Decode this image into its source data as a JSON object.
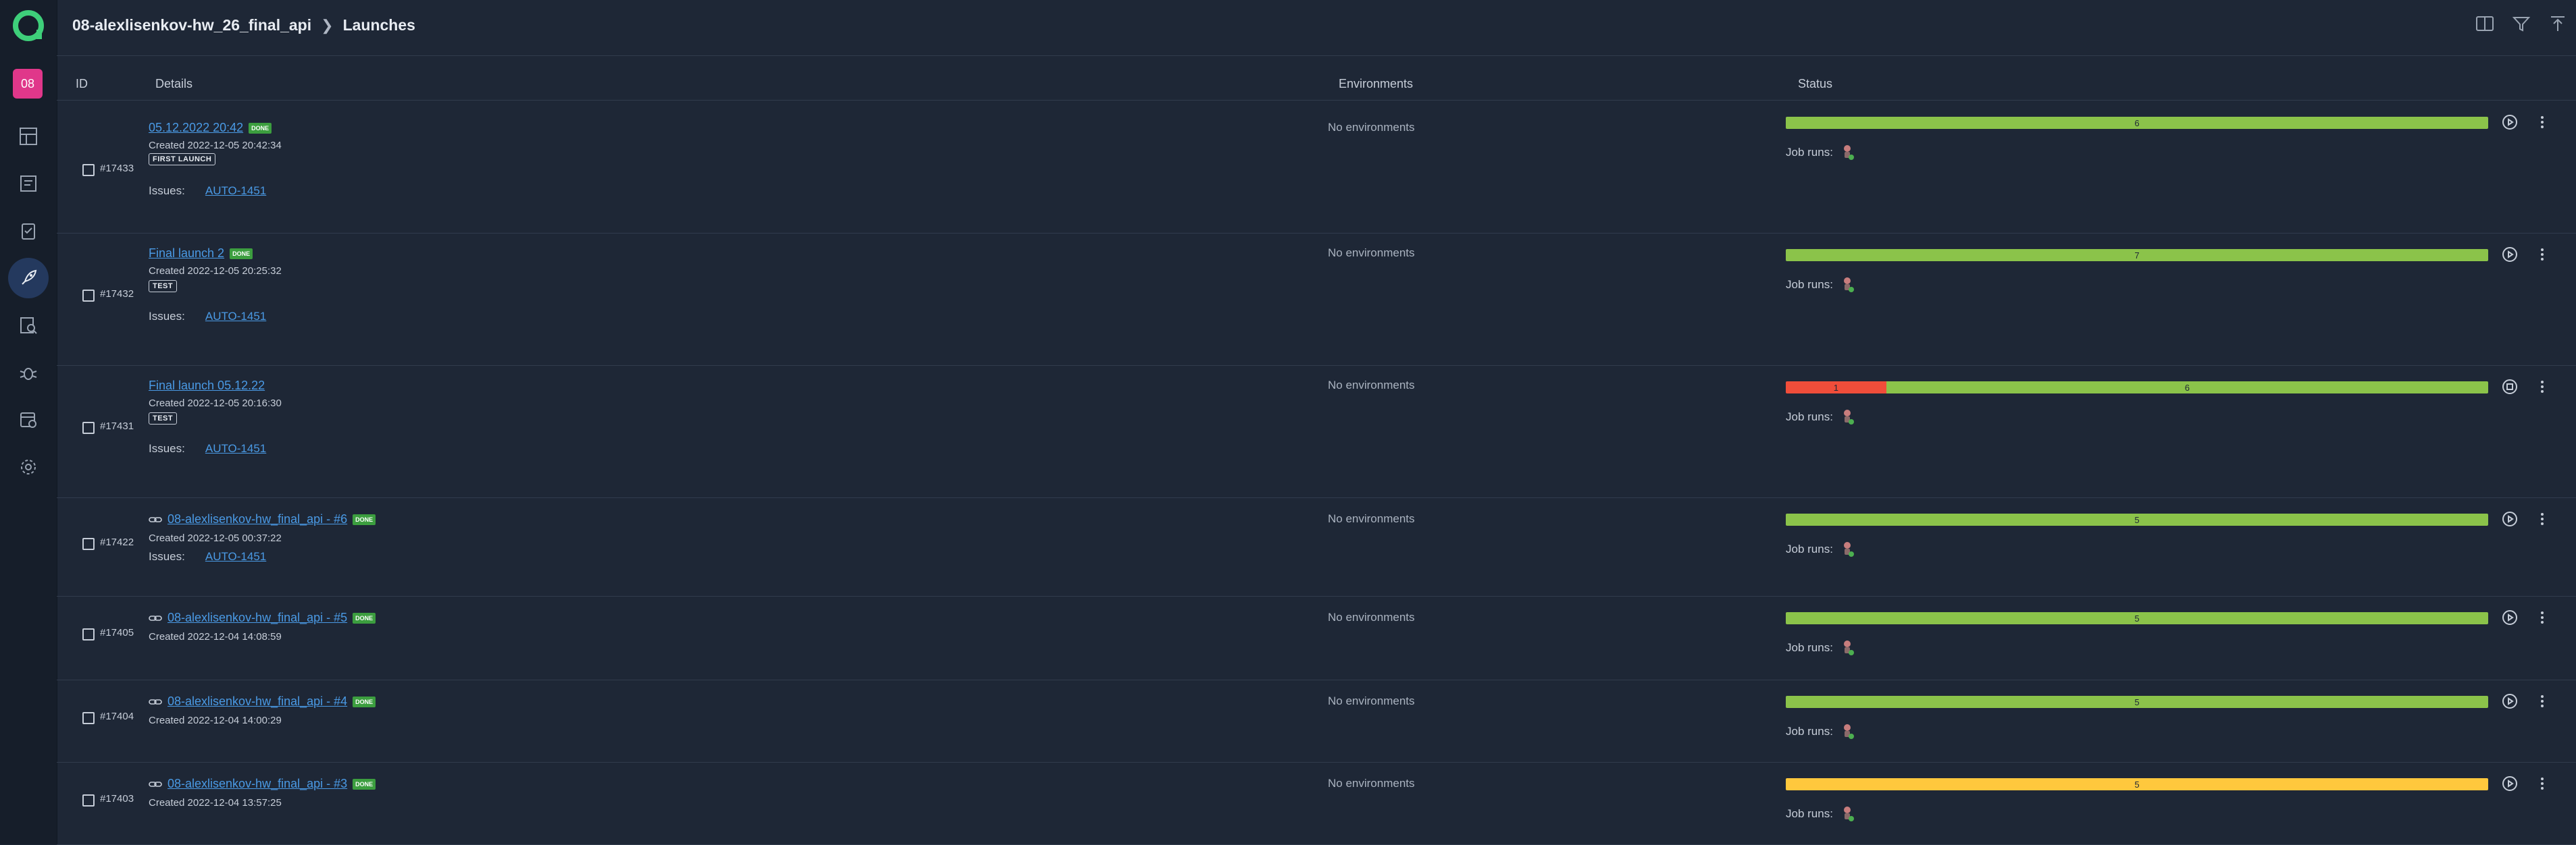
{
  "header": {
    "project": "08-alexlisenkov-hw_26_final_api",
    "page": "Launches"
  },
  "sidebar": {
    "project_badge": "08",
    "items": [
      "dashboard-icon",
      "test-cases-icon",
      "test-plans-icon",
      "launches-icon",
      "analysis-icon",
      "bugs-icon",
      "environments-icon",
      "settings-icon"
    ]
  },
  "table": {
    "columns": {
      "id": "ID",
      "details": "Details",
      "environments": "Environments",
      "status": "Status"
    },
    "job_runs_label": "Job runs:",
    "issues_label": "Issues:",
    "rows": [
      {
        "id": "#17433",
        "title": "05.12.2022 20:42",
        "linked": false,
        "done": "DONE",
        "created": "Created 2022-12-05 20:42:34",
        "tag": "FIRST LAUNCH",
        "issue": "AUTO-1451",
        "env": "No environments",
        "segments": [
          {
            "color": "green",
            "value": "6",
            "ratio": 1
          }
        ],
        "action": "play"
      },
      {
        "id": "#17432",
        "title": "Final launch 2",
        "linked": false,
        "done": "DONE",
        "created": "Created 2022-12-05 20:25:32",
        "tag": "TEST",
        "issue": "AUTO-1451",
        "env": "No environments",
        "segments": [
          {
            "color": "green",
            "value": "7",
            "ratio": 1
          }
        ],
        "action": "play"
      },
      {
        "id": "#17431",
        "title": "Final launch 05.12.22",
        "linked": false,
        "done": "",
        "created": "Created 2022-12-05 20:16:30",
        "tag": "TEST",
        "issue": "AUTO-1451",
        "env": "No environments",
        "segments": [
          {
            "color": "red",
            "value": "1",
            "ratio": 0.143
          },
          {
            "color": "green",
            "value": "6",
            "ratio": 0.857
          }
        ],
        "action": "stop"
      },
      {
        "id": "#17422",
        "title": "08-alexlisenkov-hw_final_api - #6",
        "linked": true,
        "done": "DONE",
        "created": "Created 2022-12-05 00:37:22",
        "tag": "",
        "issue": "AUTO-1451",
        "env": "No environments",
        "segments": [
          {
            "color": "green",
            "value": "5",
            "ratio": 1
          }
        ],
        "action": "play"
      },
      {
        "id": "#17405",
        "title": "08-alexlisenkov-hw_final_api - #5",
        "linked": true,
        "done": "DONE",
        "created": "Created 2022-12-04 14:08:59",
        "tag": "",
        "issue": "",
        "env": "No environments",
        "segments": [
          {
            "color": "green",
            "value": "5",
            "ratio": 1
          }
        ],
        "action": "play"
      },
      {
        "id": "#17404",
        "title": "08-alexlisenkov-hw_final_api - #4",
        "linked": true,
        "done": "DONE",
        "created": "Created 2022-12-04 14:00:29",
        "tag": "",
        "issue": "",
        "env": "No environments",
        "segments": [
          {
            "color": "green",
            "value": "5",
            "ratio": 1
          }
        ],
        "action": "play"
      },
      {
        "id": "#17403",
        "title": "08-alexlisenkov-hw_final_api - #3",
        "linked": true,
        "done": "DONE",
        "created": "Created 2022-12-04 13:57:25",
        "tag": "",
        "issue": "",
        "env": "No environments",
        "segments": [
          {
            "color": "yellow",
            "value": "5",
            "ratio": 1
          }
        ],
        "action": "play"
      }
    ]
  },
  "colors": {
    "green": "#8bc34a",
    "red": "#f04d3a",
    "yellow": "#ffc83d",
    "link": "#4a9ae5",
    "badge": "#e0378a"
  }
}
